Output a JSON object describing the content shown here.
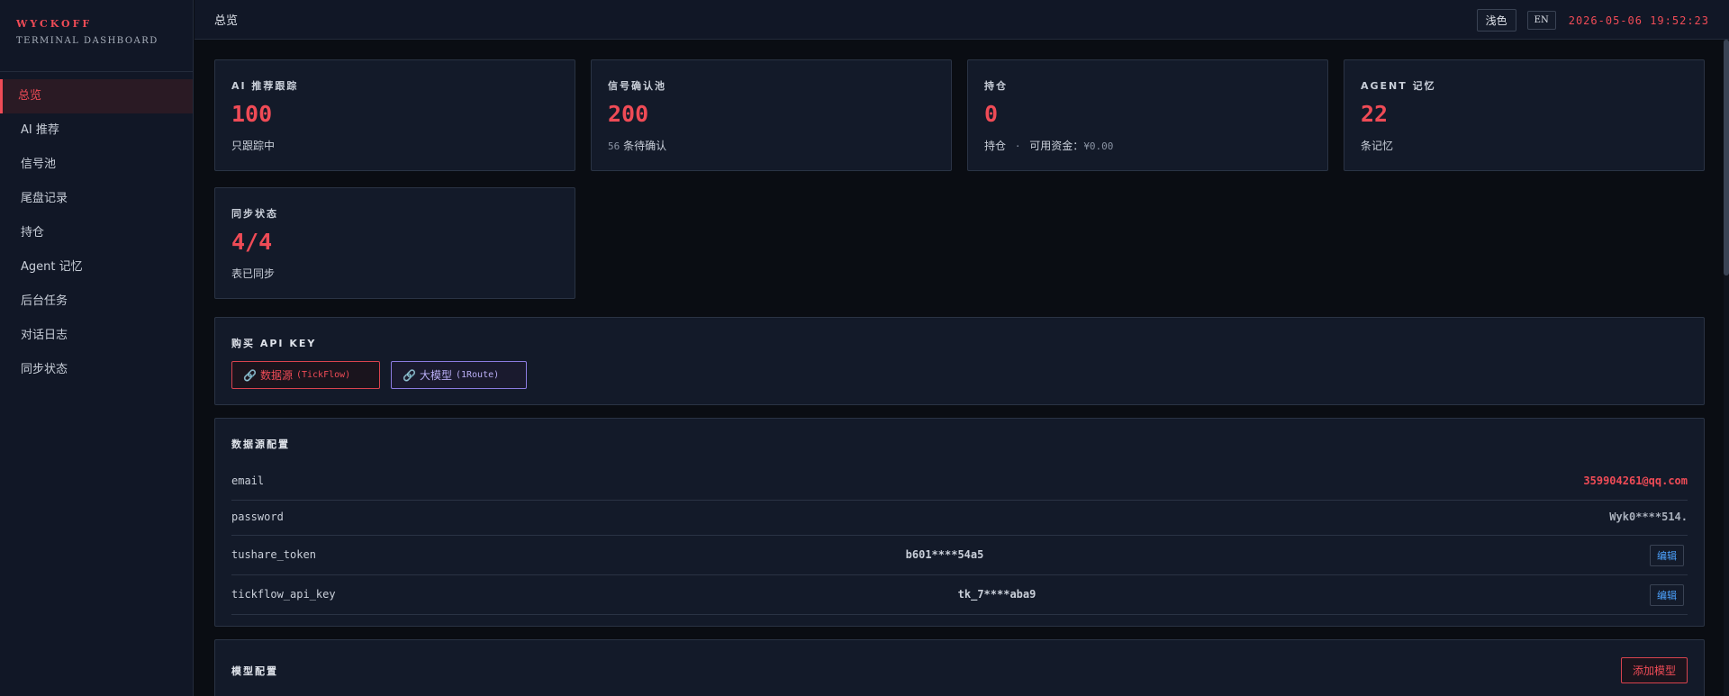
{
  "brand": {
    "name": "WYCKOFF",
    "subtitle": "TERMINAL DASHBOARD"
  },
  "sidebar": {
    "items": [
      {
        "label": "总览",
        "active": true
      },
      {
        "label": "AI 推荐"
      },
      {
        "label": "信号池"
      },
      {
        "label": "尾盘记录"
      },
      {
        "label": "持仓"
      },
      {
        "label": "Agent 记忆"
      },
      {
        "label": "后台任务"
      },
      {
        "label": "对话日志"
      },
      {
        "label": "同步状态"
      }
    ]
  },
  "header": {
    "title": "总览",
    "theme_label": "浅色",
    "lang_label": "EN",
    "datetime": "2026-05-06 19:52:23"
  },
  "cards": [
    {
      "label": "AI 推荐跟踪",
      "value": "100",
      "sub": "只跟踪中"
    },
    {
      "label": "信号确认池",
      "value": "200",
      "sub_count": "56",
      "sub": "条待确认"
    },
    {
      "label": "持仓",
      "value": "0",
      "sub": "持仓",
      "sub_sep": "·",
      "sub_extra": "可用资金：",
      "sub_money": "¥0.00"
    },
    {
      "label": "AGENT 记忆",
      "value": "22",
      "sub": "条记忆"
    },
    {
      "label": "同步状态",
      "value": "4/4",
      "sub": "表已同步"
    }
  ],
  "buy_api": {
    "title": "购买 API KEY",
    "buttons": [
      {
        "label": "数据源",
        "provider": "(TickFlow)"
      },
      {
        "label": "大模型",
        "provider": "(1Route)"
      }
    ]
  },
  "datasource": {
    "title": "数据源配置",
    "rows": [
      {
        "key": "email",
        "value": "359904261@qq.com"
      },
      {
        "key": "password",
        "value": "Wyk0****514."
      },
      {
        "key": "tushare_token",
        "value": "b601****54a5",
        "action": "编辑"
      },
      {
        "key": "tickflow_api_key",
        "value": "tk_7****aba9",
        "action": "编辑"
      }
    ]
  },
  "model_config": {
    "title": "模型配置",
    "add_label": "添加模型"
  },
  "colors": {
    "accent": "#ef4b56",
    "bg": "#0a0d13",
    "panel": "#131a29",
    "link": "#4da3ff",
    "purple": "#b9aef5"
  }
}
